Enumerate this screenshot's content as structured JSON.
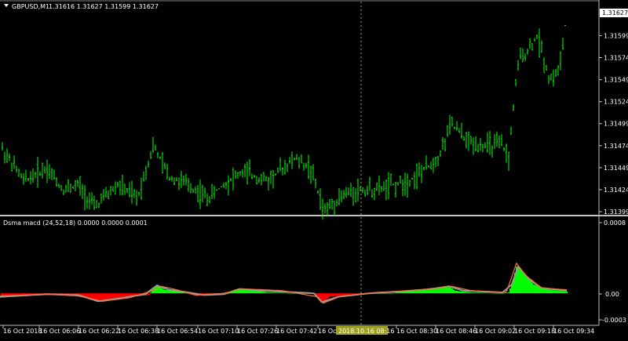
{
  "main": {
    "symbol": "GBPUSD,M1",
    "ohlc": "1.31616 1.31627 1.31599 1.31627",
    "price_levels": [
      "1.31599",
      "1.31574",
      "1.31549",
      "1.31524",
      "1.31499",
      "1.31474",
      "1.31449",
      "1.31424",
      "1.31399"
    ],
    "current_price": "1.31627",
    "colors": {
      "bars": "#00ff00",
      "background": "#000000",
      "axis": "#c0c0c0",
      "crosshair": "#a0a060"
    }
  },
  "indicator": {
    "title": "Dsma macd (24,52,18) 0.0000 0.0000 0.0001",
    "levels": [
      "0.0008",
      "0.00",
      "-0.0003"
    ],
    "colors": {
      "positive": "#00ff00",
      "negative": "#ff0000",
      "signal_gray": "#9a9a9a",
      "signal_orange": "#ff7040"
    }
  },
  "time_axis": {
    "labels": [
      "16 Oct 2018",
      "16 Oct 06:06",
      "16 Oct 06:22",
      "16 Oct 06:38",
      "16 Oct 06:54",
      "16 Oct 07:10",
      "16 Oct 07:26",
      "16 Oct 07:42",
      "16 Oct 08:",
      "16 Oct 08:30",
      "16 Oct 08:46",
      "16 Oct 09:02",
      "16 Oct 09:18",
      "16 Oct 09:34"
    ],
    "crosshair_label": "2018.10.16 08:16"
  },
  "chart_data": {
    "type": "bar",
    "price_anchors": [
      [
        0,
        1.31474
      ],
      [
        30,
        1.31434
      ],
      [
        60,
        1.31449
      ],
      [
        80,
        1.31424
      ],
      [
        100,
        1.31429
      ],
      [
        120,
        1.31404
      ],
      [
        150,
        1.31429
      ],
      [
        175,
        1.31414
      ],
      [
        195,
        1.31474
      ],
      [
        215,
        1.31439
      ],
      [
        240,
        1.31429
      ],
      [
        265,
        1.31414
      ],
      [
        290,
        1.31434
      ],
      [
        310,
        1.31444
      ],
      [
        340,
        1.31434
      ],
      [
        375,
        1.31459
      ],
      [
        395,
        1.31449
      ],
      [
        413,
        1.31399
      ],
      [
        430,
        1.31414
      ],
      [
        455,
        1.31424
      ],
      [
        480,
        1.31424
      ],
      [
        500,
        1.31429
      ],
      [
        520,
        1.31434
      ],
      [
        545,
        1.31449
      ],
      [
        560,
        1.31464
      ],
      [
        575,
        1.31499
      ],
      [
        595,
        1.31479
      ],
      [
        615,
        1.31474
      ],
      [
        640,
        1.31474
      ],
      [
        648,
        1.31459
      ],
      [
        655,
        1.31529
      ],
      [
        662,
        1.31574
      ],
      [
        670,
        1.31579
      ],
      [
        685,
        1.31599
      ],
      [
        700,
        1.31549
      ],
      [
        712,
        1.31559
      ],
      [
        718,
        1.31594
      ],
      [
        722,
        1.31627
      ]
    ],
    "hist_anchors": [
      [
        0,
        -4e-05
      ],
      [
        40,
        -2e-05
      ],
      [
        80,
        -2e-05
      ],
      [
        100,
        -3e-05
      ],
      [
        125,
        -9e-05
      ],
      [
        160,
        -4e-05
      ],
      [
        190,
        -2e-05
      ],
      [
        196,
        7e-05
      ],
      [
        200,
        9e-05
      ],
      [
        210,
        4e-05
      ],
      [
        230,
        2e-05
      ],
      [
        250,
        -3e-05
      ],
      [
        270,
        -1e-05
      ],
      [
        290,
        -1e-05
      ],
      [
        300,
        4e-05
      ],
      [
        315,
        5e-05
      ],
      [
        340,
        1e-05
      ],
      [
        380,
        0.0
      ],
      [
        400,
        0.0
      ],
      [
        408,
        -9e-05
      ],
      [
        412,
        -0.00011
      ],
      [
        420,
        -4e-05
      ],
      [
        440,
        -2e-05
      ],
      [
        460,
        0.0
      ],
      [
        500,
        0.0
      ],
      [
        515,
        3e-05
      ],
      [
        530,
        3e-05
      ],
      [
        550,
        6e-05
      ],
      [
        572,
        8e-05
      ],
      [
        580,
        3e-05
      ],
      [
        600,
        1e-05
      ],
      [
        640,
        0.0
      ],
      [
        648,
        1e-05
      ],
      [
        652,
        0.0001
      ],
      [
        658,
        0.0003
      ],
      [
        665,
        0.00025
      ],
      [
        680,
        0.0001
      ],
      [
        700,
        4e-05
      ],
      [
        722,
        2e-05
      ]
    ],
    "signal_gray": [
      [
        0,
        -4e-05
      ],
      [
        60,
        -1e-05
      ],
      [
        100,
        -2e-05
      ],
      [
        125,
        -9e-05
      ],
      [
        150,
        -6e-05
      ],
      [
        185,
        -1e-05
      ],
      [
        200,
        9e-05
      ],
      [
        215,
        4e-05
      ],
      [
        240,
        1e-05
      ],
      [
        260,
        -2e-05
      ],
      [
        285,
        -1e-05
      ],
      [
        305,
        5e-05
      ],
      [
        330,
        3e-05
      ],
      [
        380,
        1e-05
      ],
      [
        400,
        0.0
      ],
      [
        410,
        -0.0001
      ],
      [
        430,
        -4e-05
      ],
      [
        470,
        0.0
      ],
      [
        510,
        2e-05
      ],
      [
        550,
        5e-05
      ],
      [
        572,
        8e-05
      ],
      [
        590,
        3e-05
      ],
      [
        640,
        1e-05
      ],
      [
        652,
        0.0001
      ],
      [
        660,
        0.0003
      ],
      [
        675,
        0.00015
      ],
      [
        690,
        6e-05
      ],
      [
        722,
        3e-05
      ]
    ],
    "signal_orange": [
      [
        0,
        -3e-05
      ],
      [
        60,
        -1e-05
      ],
      [
        100,
        -3e-05
      ],
      [
        130,
        -9e-05
      ],
      [
        165,
        -5e-05
      ],
      [
        195,
        3e-05
      ],
      [
        205,
        8e-05
      ],
      [
        225,
        4e-05
      ],
      [
        250,
        -2e-05
      ],
      [
        285,
        0.0
      ],
      [
        310,
        5e-05
      ],
      [
        360,
        3e-05
      ],
      [
        405,
        -4e-05
      ],
      [
        412,
        -0.00011
      ],
      [
        435,
        -3e-05
      ],
      [
        480,
        1e-05
      ],
      [
        520,
        3e-05
      ],
      [
        555,
        5e-05
      ],
      [
        575,
        8e-05
      ],
      [
        600,
        3e-05
      ],
      [
        645,
        1e-05
      ],
      [
        658,
        0.00034
      ],
      [
        670,
        0.0002
      ],
      [
        690,
        6e-05
      ],
      [
        722,
        4e-05
      ]
    ]
  }
}
